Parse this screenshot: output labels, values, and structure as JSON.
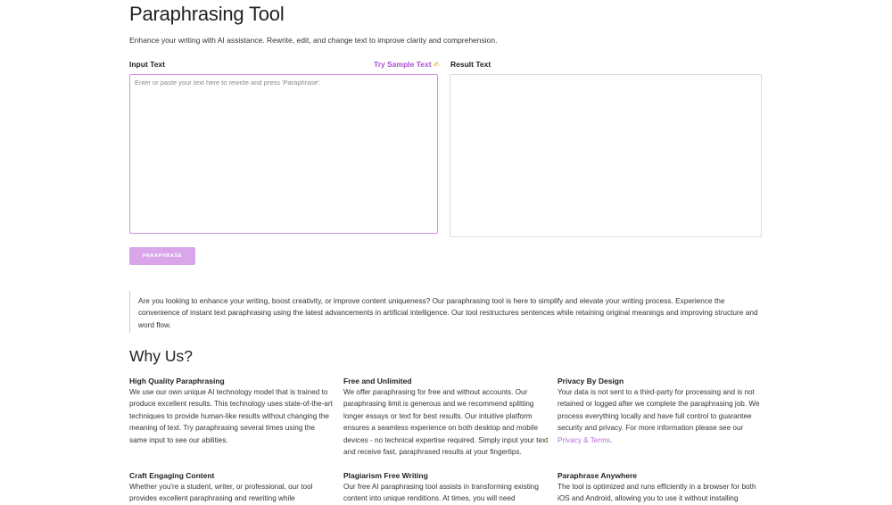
{
  "header": {
    "title": "Paraphrasing Tool",
    "subtitle": "Enhance your writing with AI assistance. Rewrite, edit, and change text to improve clarity and comprehension."
  },
  "editor": {
    "input_label": "Input Text",
    "sample_link": "Try Sample Text",
    "sample_icon": "✍",
    "input_placeholder": "Enter or paste your text here to rewrite and press 'Paraphrase'.",
    "input_value": "",
    "result_label": "Result Text",
    "paraphrase_button": "PARAPHRASE"
  },
  "intro": "Are you looking to enhance your writing, boost creativity, or improve content uniqueness? Our paraphrasing tool is here to simplify and elevate your writing process. Experience the convenience of instant text paraphrasing using the latest advancements in artificial intelligence. Our tool restructures sentences while retaining original meanings and improving structure and word flow.",
  "why_us": {
    "heading": "Why Us?",
    "features": [
      {
        "title": "High Quality Paraphrasing",
        "text": "We use our own unique AI technology model that is trained to produce excellent results. This technology uses state-of-the-art techniques to provide human-like results without changing the meaning of text. Try paraphrasing several times using the same input to see our abilities."
      },
      {
        "title": "Free and Unlimited",
        "text": "We offer paraphrasing for free and without accounts. Our paraphrasing limit is generous and we recommend splitting longer essays or text for best results. Our intuitive platform ensures a seamless experience on both desktop and mobile devices - no technical expertise required. Simply input your text and receive fast, paraphrased results at your fingertips."
      },
      {
        "title": "Privacy By Design",
        "text": "Your data is not sent to a third-party for processing and is not retained or logged after we complete the paraphrasing job. We process everything locally and have full control to guarantee security and privacy. For more information please see our",
        "link": "Privacy & Terms",
        "after_link": "."
      },
      {
        "title": "Craft Engaging Content",
        "text": "Whether you're a student, writer, or professional, our tool provides excellent paraphrasing and rewriting while"
      },
      {
        "title": "Plagiarism Free Writing",
        "text": "Our free AI paraphrasing tool assists in transforming existing content into unique renditions. At times, you will need"
      },
      {
        "title": "Paraphrase Anywhere",
        "text": "The tool is optimized and runs efficiently in a browser for both iOS and Android, allowing you to use it without installing"
      }
    ]
  }
}
